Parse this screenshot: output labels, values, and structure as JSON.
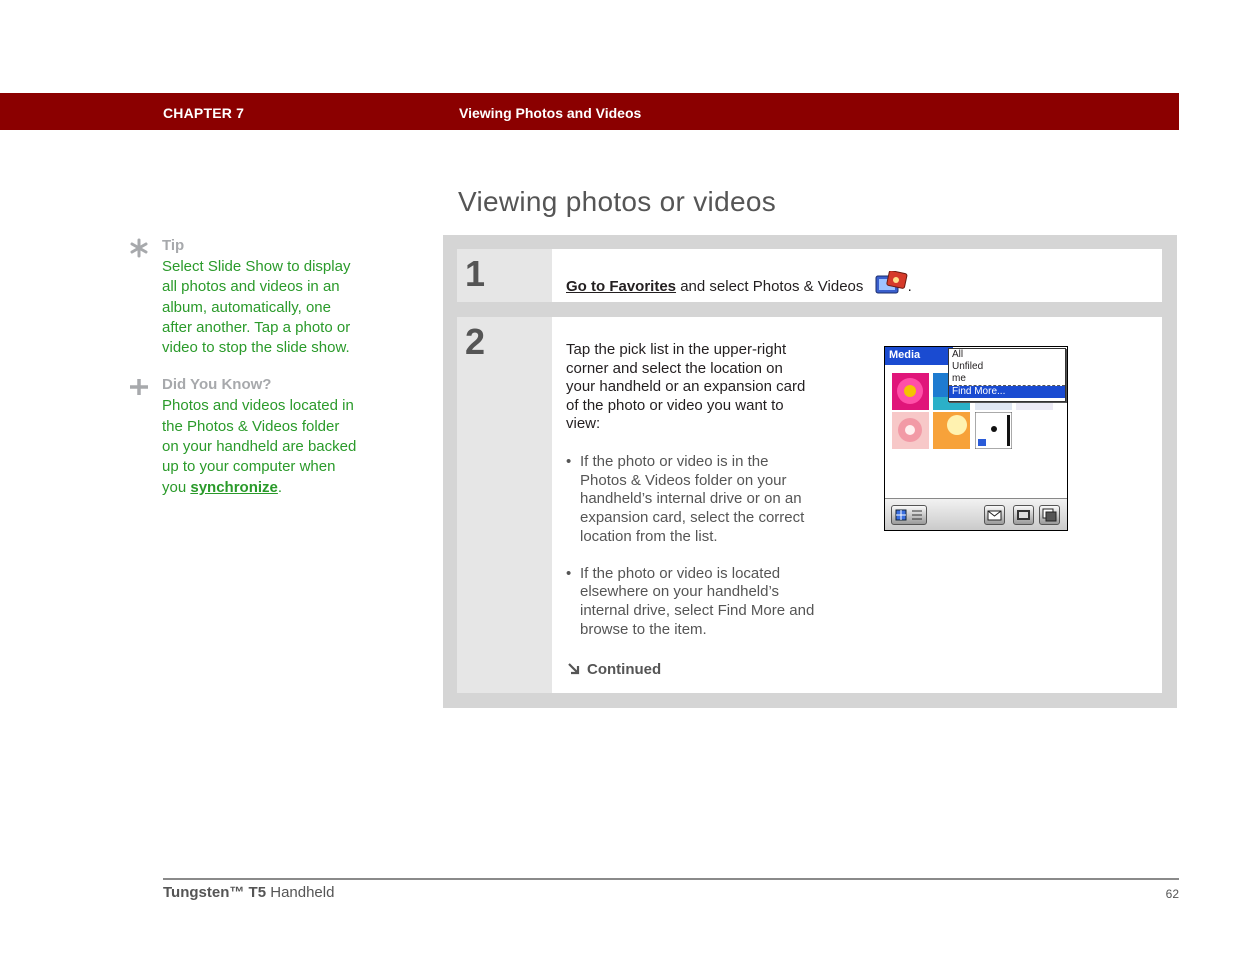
{
  "header": {
    "chapter": "CHAPTER 7",
    "title": "Viewing Photos and Videos",
    "bar_color": "#8b0000"
  },
  "page_title": "Viewing photos or videos",
  "sidebar": {
    "tip": {
      "heading": "Tip",
      "icon": "asterisk-icon",
      "body": "Select Slide Show to display all photos and videos in an album, automatically, one after another. Tap a photo or video to stop the slide show."
    },
    "did_you_know": {
      "heading": "Did You Know?",
      "icon": "plus-icon",
      "body_before": "Photos and videos located in the Photos & Videos folder on your handheld are backed up to your computer when you ",
      "link": "synchronize",
      "body_after": "."
    }
  },
  "steps": [
    {
      "number": "1",
      "link": "Go to Favorites",
      "text": " and select Photos & Videos",
      "after_icon": ".",
      "icon": "photos-videos-app-icon"
    },
    {
      "number": "2",
      "intro": "Tap the pick list in the upper-right corner and select the location on your handheld or an expansion card of the photo or video you want to view:",
      "bullets": [
        "If the photo or video is in the Photos & Videos folder on your handheld’s internal drive or on an expansion card, select the correct location from the list.",
        "If the photo or video is located elsewhere on your handheld’s internal drive, select Find More and browse to the item."
      ],
      "continued": "Continued",
      "screenshot": {
        "title": "Media",
        "menu": [
          "All",
          "Unfiled",
          "me",
          "Find More..."
        ],
        "selected_menu": "Find More..."
      }
    }
  ],
  "footer": {
    "product_bold": "Tungsten™ T5",
    "product_rest": " Handheld",
    "page_number": "62"
  },
  "colors": {
    "accent_green": "#2a9a2a",
    "box_gray": "#d5d5d5",
    "palm_blue": "#1a4bd1"
  }
}
